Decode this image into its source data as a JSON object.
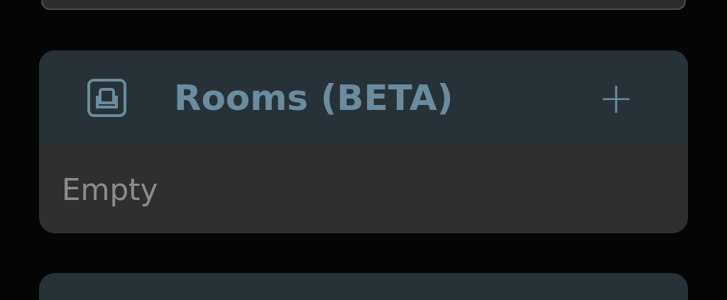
{
  "section": {
    "title": "Rooms (BETA)",
    "add_label": "+",
    "body": "Empty"
  }
}
